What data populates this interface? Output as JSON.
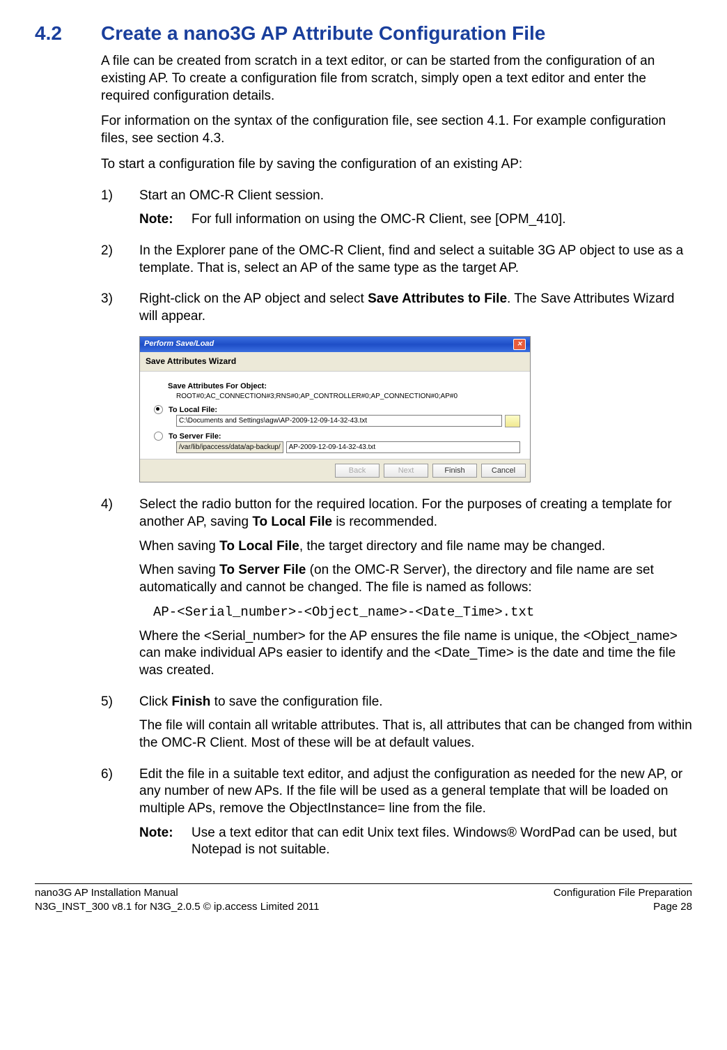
{
  "heading": {
    "num": "4.2",
    "title": "Create a nano3G AP Attribute Configuration File"
  },
  "intro": {
    "p1": "A file can be created from scratch in a text editor, or can be started from the configuration of an existing AP. To create a configuration file from scratch, simply open a text editor and enter the required configuration details.",
    "p2": "For information on the syntax of the configuration file, see section 4.1. For example configuration files, see section 4.3.",
    "p3": "To start a configuration file by saving the configuration of an existing AP:"
  },
  "steps": {
    "s1": {
      "num": "1)",
      "text": "Start an OMC-R Client session.",
      "note_label": "Note:",
      "note_text": "For full information on using the OMC-R Client, see [OPM_410]."
    },
    "s2": {
      "num": "2)",
      "text": "In the Explorer pane of the OMC-R Client, find and select a suitable 3G AP object to use as a template. That is, select an AP of the same type as the target AP."
    },
    "s3": {
      "num": "3)",
      "pre": "Right-click on the AP object and select ",
      "bold": "Save Attributes to File",
      "post": ". The Save Attributes Wizard will appear."
    },
    "s4": {
      "num": "4)",
      "p1_pre": "Select the radio button for the required location. For the purposes of creating a template for another AP, saving ",
      "p1_bold": "To Local File",
      "p1_post": " is recommended.",
      "p2_pre": "When saving ",
      "p2_bold": "To Local File",
      "p2_post": ", the target directory and file name may be changed.",
      "p3_pre": "When saving ",
      "p3_bold": "To Server File",
      "p3_post": " (on the OMC-R Server), the directory and file name are set automatically and cannot be changed. The file is named as follows:",
      "code": "AP-<Serial_number>-<Object_name>-<Date_Time>.txt",
      "p4": "Where the <Serial_number> for the AP ensures the file name is unique, the <Object_name> can make individual APs easier to identify and the <Date_Time> is the date and time the file was created."
    },
    "s5": {
      "num": "5)",
      "p1_pre": "Click ",
      "p1_bold": "Finish",
      "p1_post": " to save the configuration file.",
      "p2": "The file will contain all writable attributes. That is, all attributes that can be changed from within the OMC-R Client. Most of these will be at default values."
    },
    "s6": {
      "num": "6)",
      "p1": "Edit the file in a suitable text editor, and adjust the configuration as needed for the new AP, or any number of new APs. If the file will be used as a general template that will be loaded on multiple APs, remove the ObjectInstance= line from the file.",
      "note_label": "Note:",
      "note_text": "Use a text editor that can edit Unix text files. Windows® WordPad can be used, but Notepad is not suitable."
    }
  },
  "dialog": {
    "title": "Perform Save/Load",
    "subtitle": "Save Attributes Wizard",
    "obj_label": "Save Attributes For Object:",
    "obj_value": "ROOT#0;AC_CONNECTION#3;RNS#0;AP_CONTROLLER#0;AP_CONNECTION#0;AP#0",
    "local_label": "To Local File:",
    "local_value": "C:\\Documents and Settings\\agw\\AP-2009-12-09-14-32-43.txt",
    "server_label": "To Server File:",
    "server_prefix": "/var/lib/ipaccess/data/ap-backup/",
    "server_value": "AP-2009-12-09-14-32-43.txt",
    "buttons": {
      "back": "Back",
      "next": "Next",
      "finish": "Finish",
      "cancel": "Cancel"
    }
  },
  "footer": {
    "l1": "nano3G AP Installation Manual",
    "l2": "N3G_INST_300 v8.1 for N3G_2.0.5 © ip.access Limited 2011",
    "r1": "Configuration File Preparation",
    "r2": "Page 28"
  }
}
